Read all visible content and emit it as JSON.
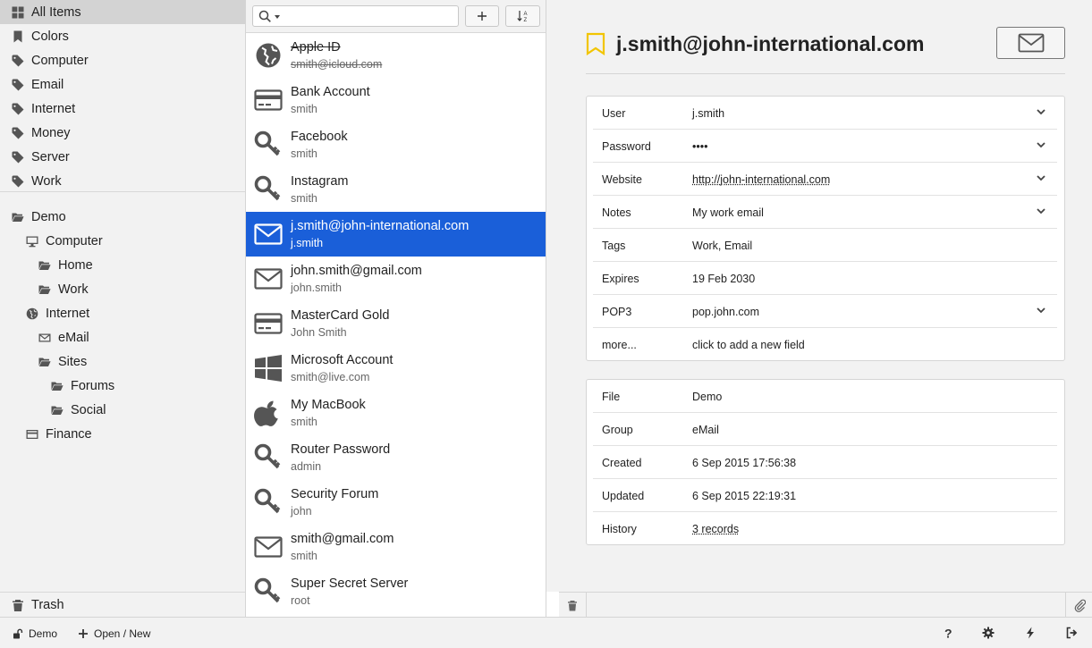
{
  "sidebar": {
    "tags": [
      {
        "label": "All Items",
        "icon": "grid-icon",
        "active": true
      },
      {
        "label": "Colors",
        "icon": "bookmark-icon"
      },
      {
        "label": "Computer",
        "icon": "tag-icon"
      },
      {
        "label": "Email",
        "icon": "tag-icon"
      },
      {
        "label": "Internet",
        "icon": "tag-icon"
      },
      {
        "label": "Money",
        "icon": "tag-icon"
      },
      {
        "label": "Server",
        "icon": "tag-icon"
      },
      {
        "label": "Work",
        "icon": "tag-icon"
      }
    ],
    "groups": [
      {
        "label": "Demo",
        "icon": "folder-open-icon",
        "level": 0
      },
      {
        "label": "Computer",
        "icon": "monitor-icon",
        "level": 1
      },
      {
        "label": "Home",
        "icon": "folder-open-icon",
        "level": 2
      },
      {
        "label": "Work",
        "icon": "folder-open-icon",
        "level": 2
      },
      {
        "label": "Internet",
        "icon": "globe-icon",
        "level": 1
      },
      {
        "label": "eMail",
        "icon": "envelope-icon",
        "level": 2
      },
      {
        "label": "Sites",
        "icon": "folder-open-icon",
        "level": 2
      },
      {
        "label": "Forums",
        "icon": "folder-open-icon",
        "level": 3
      },
      {
        "label": "Social",
        "icon": "folder-open-icon",
        "level": 3
      },
      {
        "label": "Finance",
        "icon": "card-icon",
        "level": 1
      }
    ],
    "trash_label": "Trash"
  },
  "list": {
    "search_placeholder": "",
    "items": [
      {
        "title": "Apple ID",
        "subtitle": "smith@icloud.com",
        "icon": "globe-icon",
        "deleted": true
      },
      {
        "title": "Bank Account",
        "subtitle": "smith",
        "icon": "card-icon"
      },
      {
        "title": "Facebook",
        "subtitle": "smith",
        "icon": "key-icon"
      },
      {
        "title": "Instagram",
        "subtitle": "smith",
        "icon": "key-icon"
      },
      {
        "title": "j.smith@john-international.com",
        "subtitle": "j.smith",
        "icon": "envelope-icon",
        "selected": true
      },
      {
        "title": "john.smith@gmail.com",
        "subtitle": "john.smith",
        "icon": "envelope-icon"
      },
      {
        "title": "MasterCard Gold",
        "subtitle": "John Smith",
        "icon": "card-icon"
      },
      {
        "title": "Microsoft Account",
        "subtitle": "smith@live.com",
        "icon": "windows-icon"
      },
      {
        "title": "My MacBook",
        "subtitle": "smith",
        "icon": "apple-icon"
      },
      {
        "title": "Router Password",
        "subtitle": "admin",
        "icon": "key-icon"
      },
      {
        "title": "Security Forum",
        "subtitle": "john",
        "icon": "key-icon"
      },
      {
        "title": "smith@gmail.com",
        "subtitle": "smith",
        "icon": "envelope-icon"
      },
      {
        "title": "Super Secret Server",
        "subtitle": "root",
        "icon": "key-icon"
      }
    ]
  },
  "detail": {
    "title": "j.smith@john-international.com",
    "accent_color": "#f2c500",
    "selection_color": "#1a5fd9",
    "fields": [
      {
        "label": "User",
        "value": "j.smith",
        "expandable": true
      },
      {
        "label": "Password",
        "value": "••••",
        "expandable": true
      },
      {
        "label": "Website",
        "value": "http://john-international.com",
        "expandable": true,
        "link": true
      },
      {
        "label": "Notes",
        "value": "My work email",
        "expandable": true
      },
      {
        "label": "Tags",
        "value": "Work, Email"
      },
      {
        "label": "Expires",
        "value": "19 Feb 2030"
      },
      {
        "label": "POP3",
        "value": "pop.john.com",
        "expandable": true
      },
      {
        "label": "more...",
        "value": "click to add a new field"
      }
    ],
    "meta": [
      {
        "label": "File",
        "value": "Demo"
      },
      {
        "label": "Group",
        "value": "eMail"
      },
      {
        "label": "Created",
        "value": "6 Sep 2015 17:56:38"
      },
      {
        "label": "Updated",
        "value": "6 Sep 2015 22:19:31"
      },
      {
        "label": "History",
        "value": "3 records",
        "link": true
      }
    ]
  },
  "statusbar": {
    "file_label": "Demo",
    "open_label": "Open / New"
  }
}
